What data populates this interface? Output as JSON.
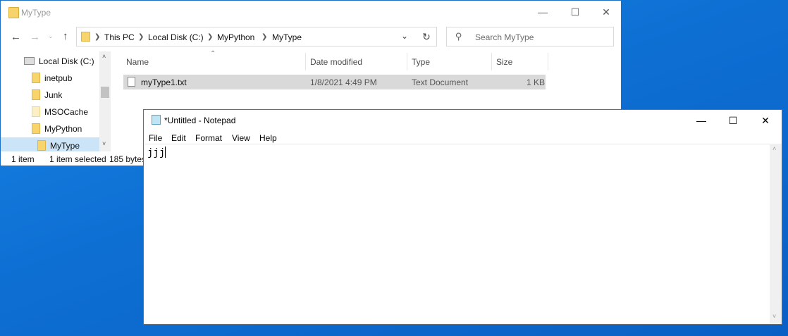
{
  "colors": {
    "desktop": "#0e6fd3",
    "selection": "#d9d9d9"
  },
  "explorer": {
    "title": "MyType",
    "address": {
      "parts": [
        "This PC",
        "Local Disk (C:)",
        "MyPython",
        "MyType"
      ]
    },
    "search": {
      "placeholder": "Search MyType"
    },
    "nav_tree": [
      {
        "label": "Local Disk (C:)",
        "icon": "drive-icon"
      },
      {
        "label": "inetpub",
        "icon": "folder-icon"
      },
      {
        "label": "Junk",
        "icon": "folder-icon"
      },
      {
        "label": "MSOCache",
        "icon": "folder-icon"
      },
      {
        "label": "MyPython",
        "icon": "folder-icon"
      },
      {
        "label": "MyType",
        "icon": "folder-icon"
      }
    ],
    "columns": [
      "Name",
      "Date modified",
      "Type",
      "Size"
    ],
    "files": [
      {
        "name": "myType1.txt",
        "date": "1/8/2021 4:49 PM",
        "type": "Text Document",
        "size": "1 KB"
      }
    ],
    "status": {
      "count": "1 item",
      "selected": "1 item selected",
      "size": "185 bytes"
    }
  },
  "notepad": {
    "title": "*Untitled - Notepad",
    "menu": [
      "File",
      "Edit",
      "Format",
      "View",
      "Help"
    ],
    "content": "jjj"
  }
}
